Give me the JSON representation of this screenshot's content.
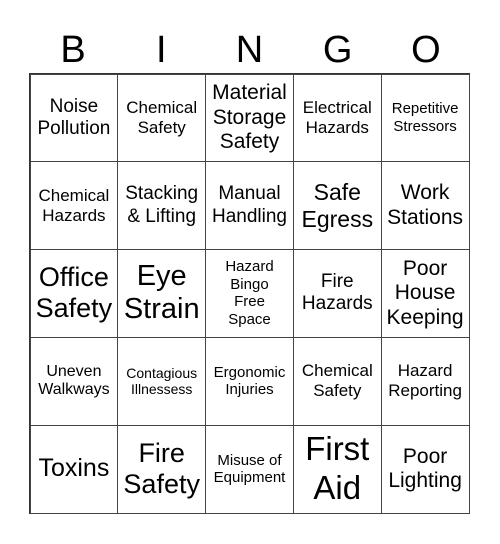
{
  "header": [
    "B",
    "I",
    "N",
    "G",
    "O"
  ],
  "cells": [
    [
      "Noise<br>Pollution",
      "Chemical<br>Safety",
      "Material<br>Storage<br>Safety",
      "Electrical<br>Hazards",
      "Repetitive<br>Stressors"
    ],
    [
      "Chemical<br>Hazards",
      "Stacking<br>& Lifting",
      "Manual<br>Handling",
      "Safe<br>Egress",
      "Work<br>Stations"
    ],
    [
      "Office<br>Safety",
      "Eye<br>Strain",
      "Hazard<br>Bingo<br>Free<br>Space",
      "Fire<br>Hazards",
      "Poor<br>House<br>Keeping"
    ],
    [
      "Uneven<br>Walkways",
      "Contagious<br>Illnessess",
      "Ergonomic<br>Injuries",
      "Chemical<br>Safety",
      "Hazard<br>Reporting"
    ],
    [
      "Toxins",
      "Fire<br>Safety",
      "Misuse of<br>Equipment",
      "First<br>Aid",
      "Poor<br>Lighting"
    ]
  ]
}
